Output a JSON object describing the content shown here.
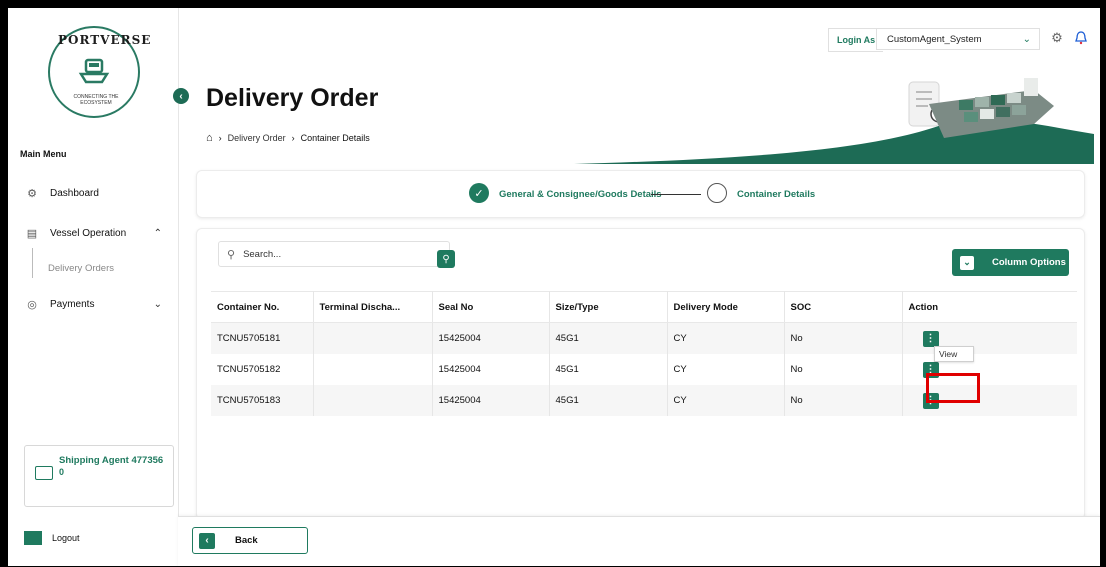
{
  "brand": {
    "logo_top": "PORTVERSE",
    "logo_bottom": "CONNECTING THE ECOSYSTEM"
  },
  "header": {
    "login_as_label": "Login As",
    "role_value": "CustomAgent_System",
    "settings_icon": "gear-icon",
    "notification_icon": "bell-icon"
  },
  "sidebar": {
    "main_menu_label": "Main Menu",
    "items": [
      {
        "label": "Dashboard",
        "icon": "dashboard-icon"
      },
      {
        "label": "Vessel Operation",
        "icon": "ship-icon"
      },
      {
        "label": "Delivery Orders",
        "icon": ""
      },
      {
        "label": "Payments",
        "icon": "payment-icon"
      }
    ],
    "agent_name": "Shipping Agent 477356",
    "agent_sub": "0",
    "logout_label": "Logout"
  },
  "page": {
    "title": "Delivery Order",
    "breadcrumb": [
      "Delivery Order",
      "Container Details"
    ]
  },
  "stepper": {
    "step1": "General & Consignee/Goods Details",
    "step2": "Container Details"
  },
  "table_card": {
    "search_placeholder": "Search...",
    "column_options_label": "Column Options",
    "columns": [
      "Container No.",
      "Terminal Discha...",
      "Seal No",
      "Size/Type",
      "Delivery Mode",
      "SOC",
      "Action"
    ],
    "rows": [
      {
        "container": "TCNU5705181",
        "terminal": "",
        "seal": "15425004",
        "size": "45G1",
        "mode": "CY",
        "soc": "No"
      },
      {
        "container": "TCNU5705182",
        "terminal": "",
        "seal": "15425004",
        "size": "45G1",
        "mode": "CY",
        "soc": "No"
      },
      {
        "container": "TCNU5705183",
        "terminal": "",
        "seal": "15425004",
        "size": "45G1",
        "mode": "CY",
        "soc": "No"
      }
    ],
    "action_menu_item": "View"
  },
  "footer": {
    "back_label": "Back"
  },
  "colors": {
    "accent": "#1f7a5f",
    "highlight": "#e00000"
  }
}
